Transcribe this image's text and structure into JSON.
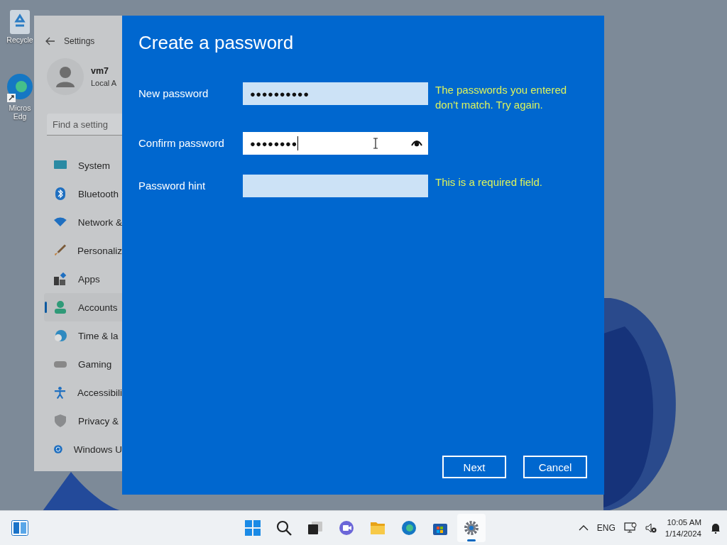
{
  "desktop_icons": [
    {
      "label": "Recycle"
    },
    {
      "label": "Micros Edg"
    }
  ],
  "settings_window": {
    "title": "Settings",
    "user_name": "vm7",
    "account_type": "Local A",
    "search": {
      "placeholder": "Find a setting"
    },
    "nav_items": [
      {
        "label": "System",
        "selected": false
      },
      {
        "label": "Bluetooth",
        "selected": false
      },
      {
        "label": "Network &",
        "selected": false
      },
      {
        "label": "Personaliz",
        "selected": false
      },
      {
        "label": "Apps",
        "selected": false
      },
      {
        "label": "Accounts",
        "selected": true
      },
      {
        "label": "Time & la",
        "selected": false
      },
      {
        "label": "Gaming",
        "selected": false
      },
      {
        "label": "Accessibili",
        "selected": false
      },
      {
        "label": "Privacy & ",
        "selected": false
      },
      {
        "label": "Windows U",
        "selected": false
      }
    ]
  },
  "dialog": {
    "title": "Create a password",
    "fields": [
      {
        "label": "New password",
        "value": "●●●●●●●●●●",
        "focused": false,
        "error": "The passwords you entered don’t match. Try again."
      },
      {
        "label": "Confirm password",
        "value": "●●●●●●●●",
        "focused": true
      },
      {
        "label": "Password hint",
        "focused": false,
        "error": "This is a required field."
      }
    ],
    "buttons": [
      "Next",
      "Cancel"
    ]
  },
  "taskbar": {
    "apps": [
      {
        "selected": false
      },
      {
        "selected": false
      },
      {
        "selected": false
      },
      {
        "selected": false
      },
      {
        "selected": false
      },
      {
        "selected": false
      },
      {
        "selected": false
      },
      {
        "selected": true
      }
    ],
    "language": "ENG",
    "time": "10:05 AM",
    "date": "1/14/2024"
  }
}
